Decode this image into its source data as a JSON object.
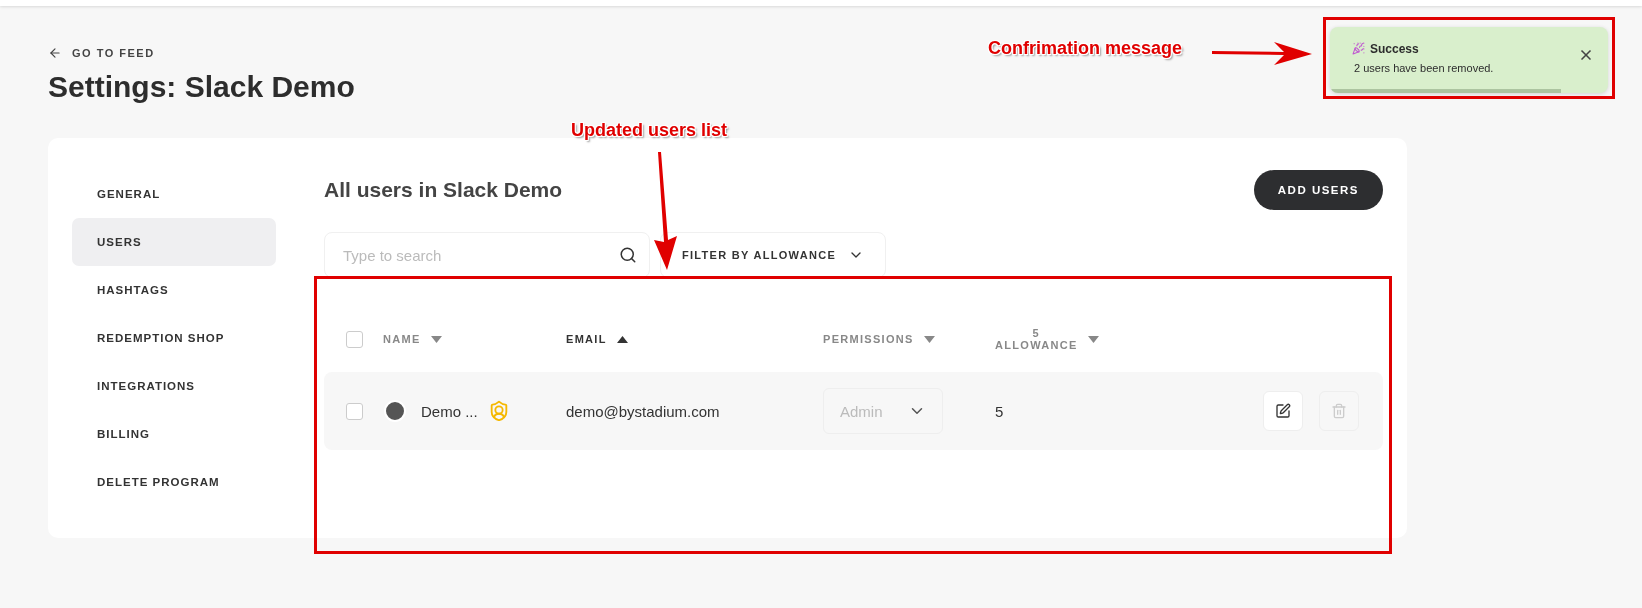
{
  "header": {
    "back_link": "GO TO FEED",
    "title": "Settings: Slack Demo"
  },
  "sidebar": {
    "items": [
      {
        "label": "GENERAL",
        "selected": false
      },
      {
        "label": "USERS",
        "selected": true
      },
      {
        "label": "HASHTAGS",
        "selected": false
      },
      {
        "label": "REDEMPTION SHOP",
        "selected": false
      },
      {
        "label": "INTEGRATIONS",
        "selected": false
      },
      {
        "label": "BILLING",
        "selected": false
      },
      {
        "label": "DELETE PROGRAM",
        "selected": false
      }
    ]
  },
  "content": {
    "title": "All users in Slack Demo",
    "add_button": "ADD USERS",
    "search": {
      "placeholder": "Type to search"
    },
    "filter": "FILTER BY ALLOWANCE"
  },
  "table": {
    "select_all_checked": false,
    "columns": [
      {
        "label": "NAME",
        "ascending": false,
        "active": false
      },
      {
        "label": "EMAIL",
        "ascending": true,
        "active": true
      },
      {
        "label": "PERMISSIONS",
        "ascending": false,
        "active": false
      },
      {
        "label": "ALLOWANCE",
        "count": "5",
        "ascending": false,
        "active": false
      }
    ],
    "rows": [
      {
        "checked": false,
        "name": "Demo ...",
        "admin": true,
        "email": "demo@bystadium.com",
        "permission": "Admin",
        "permission_disabled": true,
        "allowance": "5",
        "delete_disabled": true
      }
    ]
  },
  "toast": {
    "title": "Success",
    "message": "2 users have been removed.",
    "level": 0.83
  },
  "annotations": [
    {
      "kind": "side",
      "label": "Confrimation message"
    },
    {
      "kind": "down",
      "label": "Updated users list"
    }
  ]
}
